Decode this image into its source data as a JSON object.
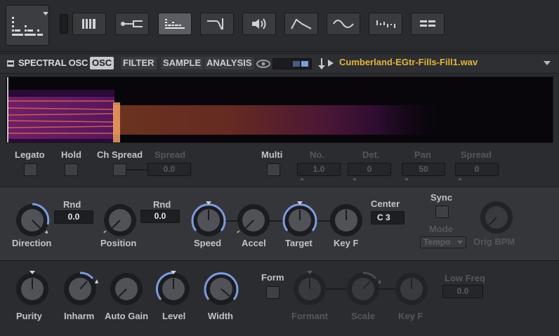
{
  "header": {
    "title": "SPECTRAL OSC",
    "tabs": [
      {
        "label": "OSC",
        "active": true
      },
      {
        "label": "FILTER",
        "active": false
      },
      {
        "label": "SAMPLE",
        "active": false
      },
      {
        "label": "ANALYSIS",
        "active": false
      }
    ],
    "file_name": "Cumberland-EGtr-Fills-Fill1.wav"
  },
  "toolbar": {
    "icons": [
      "spectral-icon",
      "keyboard-icon",
      "pitch-icon",
      "spectral-grid-icon",
      "filter-icon",
      "speaker-icon",
      "envelope-icon",
      "lfo-icon",
      "step-icon",
      "list-icon"
    ]
  },
  "row1": {
    "legato": "Legato",
    "hold": "Hold",
    "ch_spread": "Ch Spread",
    "spread": "Spread",
    "spread_value": "0.0",
    "multi": "Multi",
    "no": "No.",
    "no_value": "1.0",
    "det": "Det.",
    "det_value": "0",
    "pan": "Pan",
    "pan_value": "50",
    "spread2": "Spread",
    "spread2_value": "0"
  },
  "row2": {
    "direction": "Direction",
    "rnd1": "Rnd",
    "rnd1_value": "0.0",
    "position": "Position",
    "rnd2": "Rnd",
    "rnd2_value": "0.0",
    "speed": "Speed",
    "accel": "Accel",
    "target": "Target",
    "keyf": "Key F",
    "center": "Center",
    "center_value": "C 3",
    "sync": "Sync",
    "mode": "Mode",
    "mode_value": "Tempo",
    "orig_bpm": "Orig BPM"
  },
  "row3": {
    "purity": "Purity",
    "inharm": "Inharm",
    "auto_gain": "Auto Gain",
    "level": "Level",
    "width": "Width",
    "form": "Form",
    "formant": "Formant",
    "scale": "Scale",
    "keyf": "Key F",
    "low_freq": "Low Freq",
    "low_freq_value": "0.0"
  },
  "colors": {
    "accent_knob": "#7f9be0",
    "file_name": "#e1b63a",
    "active_tab": "#c8cacd"
  }
}
